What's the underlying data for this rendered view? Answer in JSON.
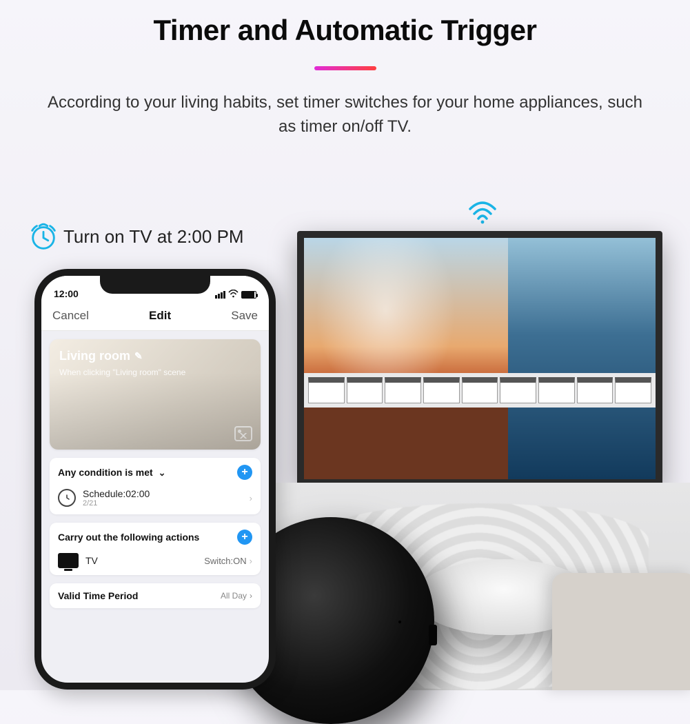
{
  "headline": "Timer and Automatic Trigger",
  "subhead": "According to your living habits, set timer switches for your home appliances, such as timer on/off TV.",
  "caption": "Turn on TV at 2:00 PM",
  "phone": {
    "status_time": "12:00",
    "nav": {
      "left": "Cancel",
      "title": "Edit",
      "right": "Save"
    },
    "hero": {
      "title": "Living room",
      "sub": "When clicking \"Living room\" scene"
    },
    "cond_card": {
      "title": "Any condition is met",
      "schedule_label": "Schedule:02:00",
      "schedule_date": "2/21"
    },
    "action_card": {
      "title": "Carry out the following actions",
      "item_label": "TV",
      "item_value": "Switch:ON"
    },
    "valid_card": {
      "title": "Valid Time Period",
      "value": "All Day"
    }
  }
}
